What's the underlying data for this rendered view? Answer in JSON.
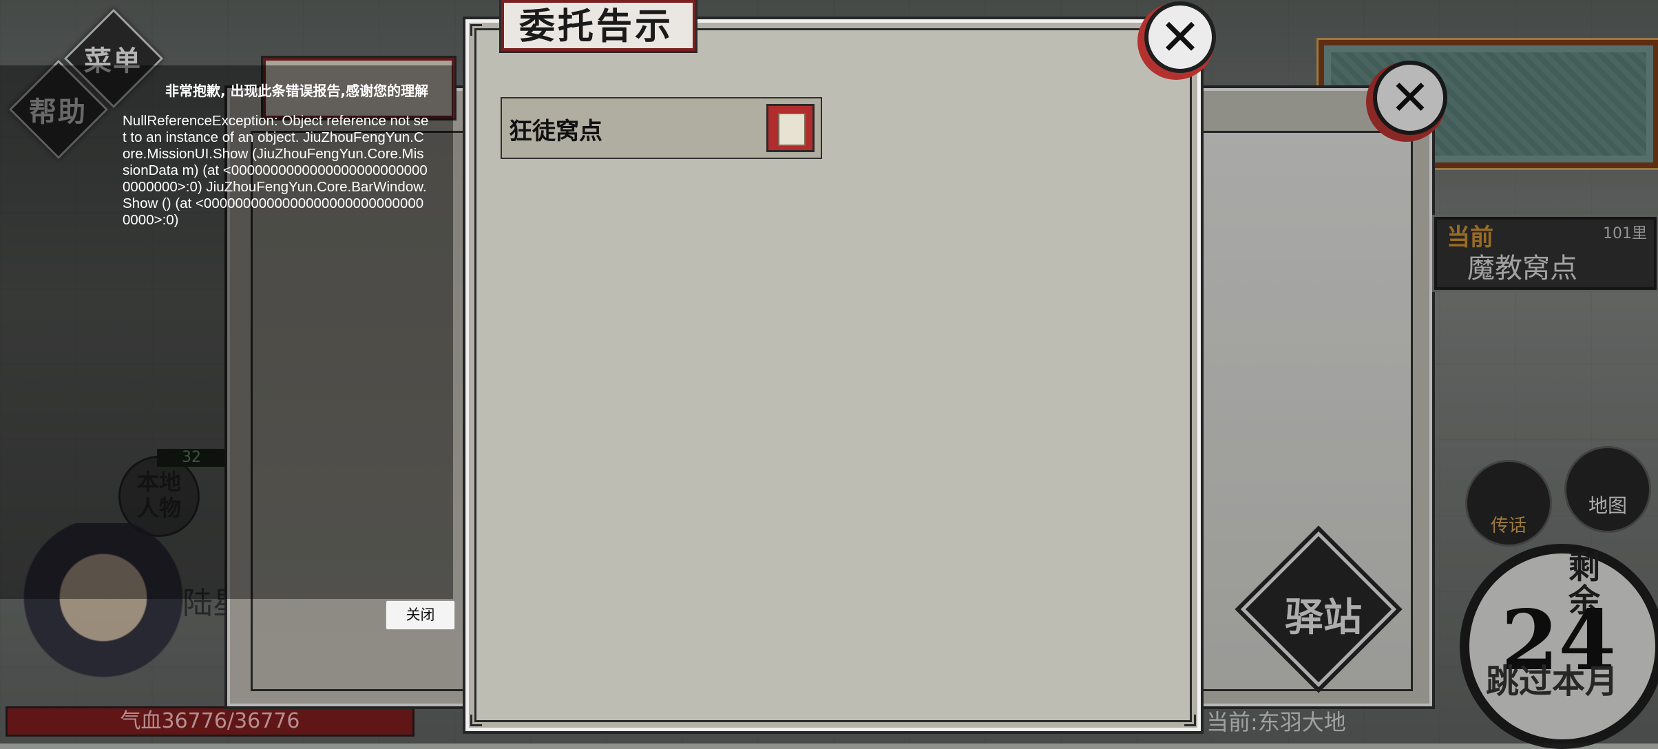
{
  "hud": {
    "menu_label": "菜单",
    "help_label": "帮助",
    "local_people_label": "本地人物",
    "local_count": "32",
    "player_name_partial": "陆星",
    "hp_label": "气血36776/36776"
  },
  "left_panel": {
    "close_label": "关闭"
  },
  "error_report": {
    "title": "非常抱歉, 出现此条错误报告,感谢您的理解",
    "message": "NullReferenceException: Object reference not set to an instance of an object. JiuZhouFengYun.Core.MissionUI.Show (JiuZhouFengYun.Core.MissionData m) (at <00000000000000000000000000000000>:0) JiuZhouFengYun.Core.BarWindow.Show () (at <00000000000000000000000000000000>:0)",
    "close_button": "关闭"
  },
  "dialog": {
    "title": "委托告示",
    "close_icon": "✕",
    "missions": [
      {
        "label": "狂徒窝点"
      }
    ]
  },
  "right_hud": {
    "current_label": "当前",
    "distance": "101里",
    "location_name": "魔教窝点",
    "talk_label": "传话",
    "map_label": "地图",
    "station_label": "驿站",
    "remain_label": "剩余",
    "remain_days": "24",
    "skip_label": "跳过本月",
    "current_area": "当前:东羽大地",
    "close_icon": "✕"
  },
  "colors": {
    "accent_red": "#b3322f",
    "hp_red": "#7c1d1d",
    "panel": "#bebdb4"
  }
}
